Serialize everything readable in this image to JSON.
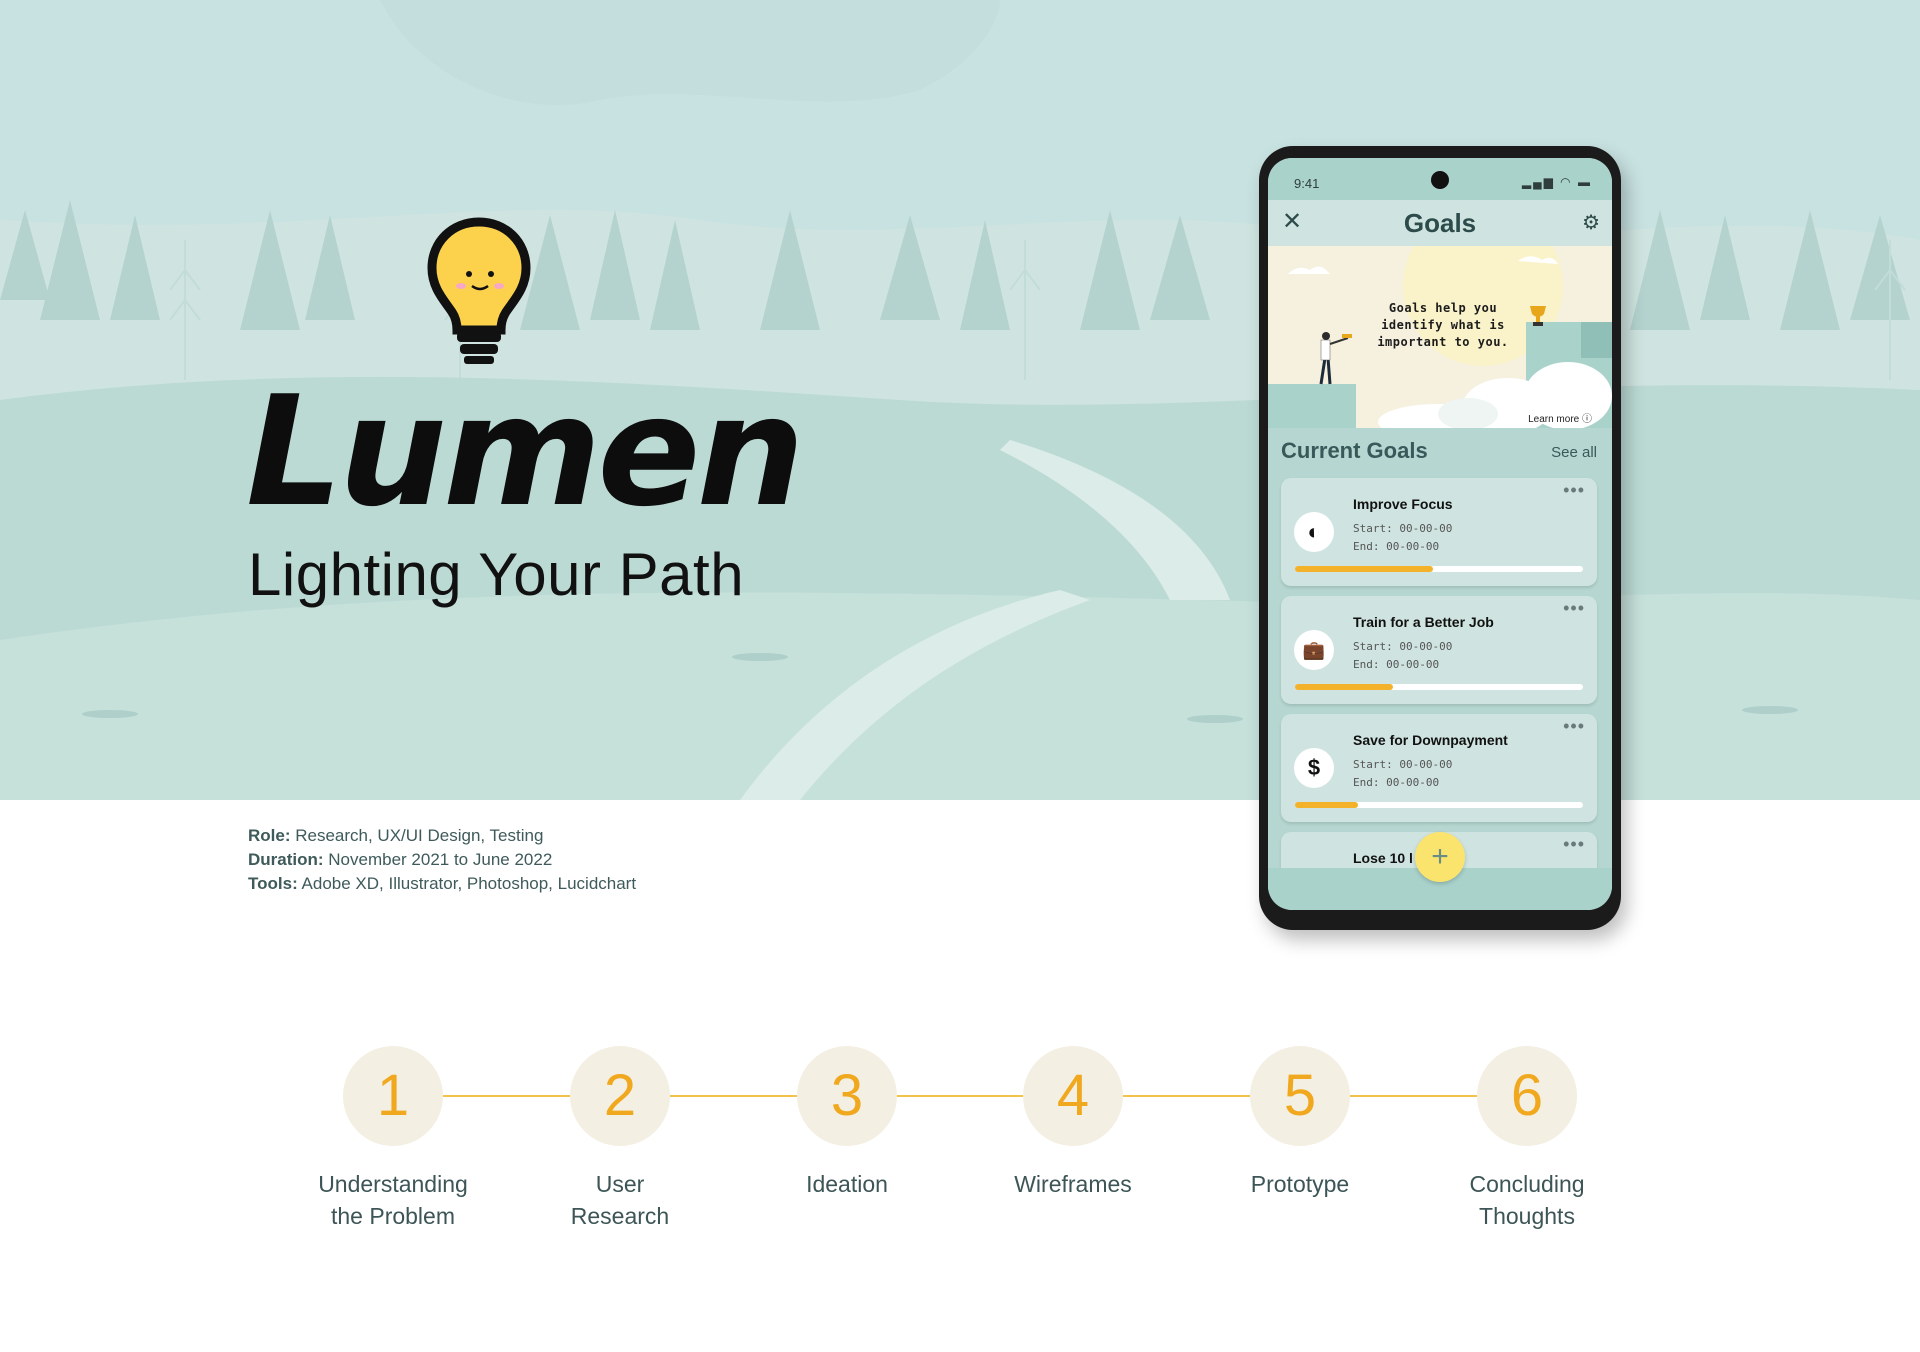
{
  "hero": {
    "title": "Lumen",
    "tagline": "Lighting Your Path"
  },
  "meta": {
    "role_label": "Role:",
    "role_value": "Research, UX/UI Design, Testing",
    "duration_label": "Duration:",
    "duration_value": "November 2021 to June 2022",
    "tools_label": "Tools:",
    "tools_value": "Adobe XD, Illustrator, Photoshop, Lucidchart"
  },
  "phone": {
    "time": "9:41",
    "status_icons": "▂▄▆ ◠ ▬",
    "header_title": "Goals",
    "close_icon": "✕",
    "gear_icon": "⚙",
    "banner_text": "Goals help you identify what is important to you.",
    "learn_more": "Learn more ⓘ",
    "section_title": "Current Goals",
    "see_all": "See all",
    "goals": [
      {
        "name": "Improve Focus",
        "start": "Start: 00-00-00",
        "end": "End: 00-00-00",
        "icon": "brain-icon",
        "glyph": "◐",
        "progress": 0.48
      },
      {
        "name": "Train for a Better Job",
        "start": "Start: 00-00-00",
        "end": "End: 00-00-00",
        "icon": "briefcase-icon",
        "glyph": "💼",
        "progress": 0.34
      },
      {
        "name": "Save for Downpayment",
        "start": "Start: 00-00-00",
        "end": "End: 00-00-00",
        "icon": "dollar-icon",
        "glyph": "$",
        "progress": 0.22
      },
      {
        "name": "Lose 10 l",
        "icon": "scale-icon"
      }
    ],
    "more_glyph": "•••",
    "fab": "+"
  },
  "steps": [
    {
      "number": "1",
      "line1": "Understanding",
      "line2": "the Problem"
    },
    {
      "number": "2",
      "line1": "User",
      "line2": "Research"
    },
    {
      "number": "3",
      "line1": "Ideation",
      "line2": ""
    },
    {
      "number": "4",
      "line1": "Wireframes",
      "line2": ""
    },
    {
      "number": "5",
      "line1": "Prototype",
      "line2": ""
    },
    {
      "number": "6",
      "line1": "Concluding",
      "line2": "Thoughts"
    }
  ],
  "colors": {
    "hero_bg": "#cfe4e0",
    "accent": "#f3b22a",
    "step_circle": "#f4efe3",
    "text_dark": "#3d5556"
  }
}
